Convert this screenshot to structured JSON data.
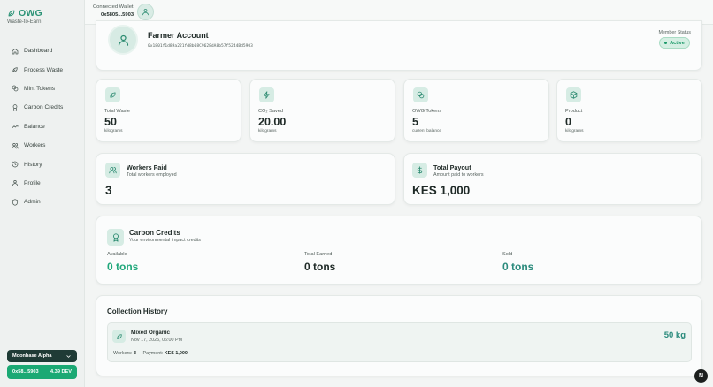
{
  "app": {
    "brand": "OWG",
    "tagline": "Waste-to-Earn"
  },
  "sidebar": {
    "items": [
      {
        "label": "Dashboard",
        "icon": "home-icon"
      },
      {
        "label": "Process Waste",
        "icon": "leaf-icon"
      },
      {
        "label": "Mint Tokens",
        "icon": "coins-icon"
      },
      {
        "label": "Carbon Credits",
        "icon": "award-icon"
      },
      {
        "label": "Balance",
        "icon": "trending-up-icon"
      },
      {
        "label": "Workers",
        "icon": "users-icon"
      },
      {
        "label": "History",
        "icon": "history-icon"
      },
      {
        "label": "Profile",
        "icon": "user-icon"
      },
      {
        "label": "Admin",
        "icon": "shield-icon"
      }
    ],
    "network": "Moonbase Alpha",
    "wallet_short": "0x58...5903",
    "balance": "4.39 DEV"
  },
  "topbar": {
    "label": "Connected Wallet",
    "address": "0x5805...5903"
  },
  "profile": {
    "title": "Farmer Account",
    "hash": "0x1801f1d89a221fd8b08C9628dA8b57f5244Bd5903",
    "status_label": "Member Status",
    "status": "Active"
  },
  "stats": [
    {
      "label": "Total Waste",
      "value": "50",
      "unit": "kilograms",
      "icon": "leaf-icon"
    },
    {
      "label": "CO₂ Saved",
      "value": "20.00",
      "unit": "kilograms",
      "icon": "lightning-icon"
    },
    {
      "label": "OWG Tokens",
      "value": "5",
      "unit": "current balance",
      "icon": "coins-icon"
    },
    {
      "label": "Product",
      "value": "0",
      "unit": "kilograms",
      "icon": "box-icon"
    }
  ],
  "workers": {
    "title": "Workers Paid",
    "subtitle": "Total workers employed",
    "value": "3"
  },
  "payout": {
    "title": "Total Payout",
    "subtitle": "Amount paid to workers",
    "value": "KES 1,000"
  },
  "carbon": {
    "title": "Carbon Credits",
    "subtitle": "Your environmental impact credits",
    "available_label": "Available",
    "available_value": "0 tons",
    "earned_label": "Total Earned",
    "earned_value": "0 tons",
    "sold_label": "Sold",
    "sold_value": "0 tons"
  },
  "history": {
    "title": "Collection History",
    "items": [
      {
        "type": "Mixed Organic",
        "date": "Nov 17, 2025, 06:00 PM",
        "weight": "50 kg",
        "workers_label": "Workers:",
        "workers": "3",
        "payment_label": "Payment:",
        "payment": "KES 1,000"
      }
    ]
  },
  "fab": "N",
  "colors": {
    "accent": "#2e9478",
    "green_value": "#1fa77a",
    "teal_value": "#2a8a7c",
    "dark_button": "#1f3b36",
    "balance_button": "#1ba974"
  }
}
